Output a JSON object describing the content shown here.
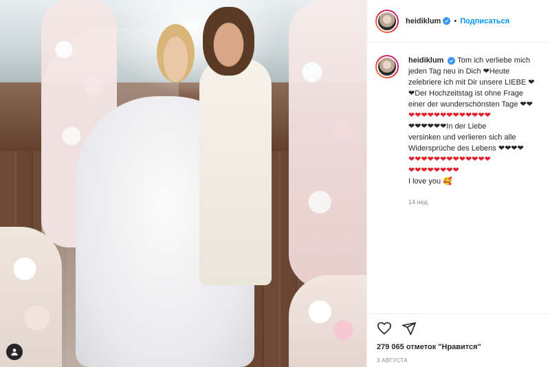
{
  "header": {
    "username": "heidiklum",
    "separator": "•",
    "follow_label": "Подписаться"
  },
  "caption": {
    "username": "heidiklum",
    "text_lines": [
      "Tom ich verliebe mich",
      "jeden Tag neu in Dich ❤Heute",
      "zelebriere ich mit Dir unsere LIEBE ❤",
      "❤Der Hochzeitstag ist ohne Frage",
      "einer der wunderschönsten Tage ❤❤",
      "❤❤❤❤❤❤❤❤❤❤❤❤❤",
      "❤❤❤❤❤❤In der Liebe",
      "versinken und verlieren sich alle",
      "Widersprüche des Lebens ❤❤❤❤",
      "❤❤❤❤❤❤❤❤❤❤❤❤❤",
      "❤❤❤❤❤❤❤❤",
      "I love you 🥰"
    ],
    "time": "14 нед."
  },
  "footer": {
    "likes": "279 065 отметок \"Нравится\"",
    "date": "3 АВГУСТА"
  },
  "colors": {
    "accent": "#0095f6",
    "verified": "#3897f0",
    "heart": "#e0202a",
    "muted": "#8e8e8e"
  },
  "icons": [
    "verified-icon",
    "heart-icon",
    "share-icon",
    "user-tag-icon"
  ]
}
